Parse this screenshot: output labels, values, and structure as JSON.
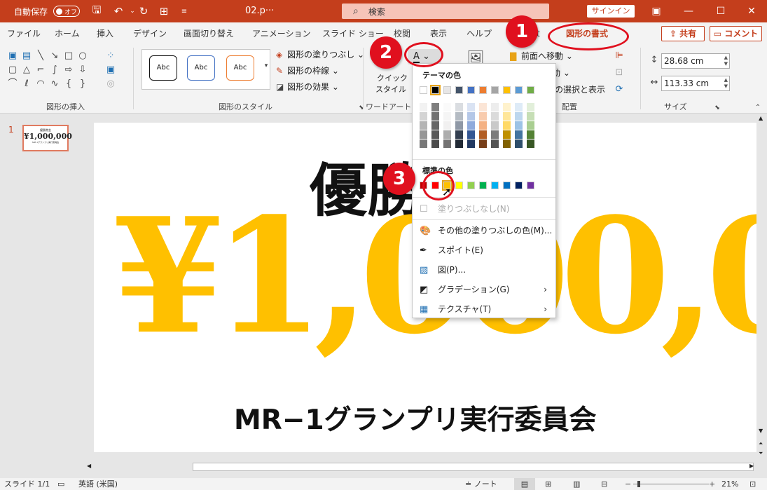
{
  "titlebar": {
    "autosave_label": "自動保存",
    "autosave_state": "オフ",
    "filename": "02.p···",
    "search_placeholder": "検索",
    "signin_label": "サインイン"
  },
  "tabs": [
    "ファイル",
    "ホーム",
    "挿入",
    "デザイン",
    "画面切り替え",
    "アニメーション",
    "スライド ショー",
    "校閲",
    "表示",
    "ヘルプ",
    "t",
    "図形の書式"
  ],
  "tab_buttons": {
    "share": "共有",
    "comment": "コメント"
  },
  "ribbon": {
    "insert_shapes_label": "図形の挿入",
    "shape_styles_label": "図形のスタイル",
    "style_sample": "Abc",
    "fill_label": "図形の塗りつぶし",
    "outline_label": "図形の枠線",
    "effects_label": "図形の効果",
    "quick_style_label": "クイック",
    "quick_style_label2": "スタイル",
    "wordart_label": "ワードアートの",
    "bring_forward": "前面へ移動",
    "send_backward": "動",
    "selection_pane": "の選択と表示",
    "arrange_label": "配置",
    "height_value": "28.68 cm",
    "width_value": "113.33 cm",
    "size_label": "サイズ"
  },
  "slide": {
    "number": "1",
    "heading": "優勝",
    "amount": "¥1,000,000",
    "committee": "MR−1グランプリ実行委員会"
  },
  "thumb": {
    "line1": "優勝賞金",
    "line2": "¥1,000,000",
    "line3": "MR-1グランプリ実行委員会"
  },
  "dropdown": {
    "theme_colors_label": "テーマの色",
    "standard_colors_label": "標準の色",
    "no_fill": "塗りつぶしなし(N)",
    "more_colors": "その他の塗りつぶしの色(M)...",
    "eyedropper": "スポイト(E)",
    "picture": "図(P)...",
    "gradient": "グラデーション(G)",
    "texture": "テクスチャ(T)",
    "theme_row": [
      "#ffffff",
      "#000000",
      "#e7e6e6",
      "#44546a",
      "#4472c4",
      "#ed7d31",
      "#a5a5a5",
      "#ffc000",
      "#5b9bd5",
      "#70ad47"
    ],
    "standard_row": [
      "#c00000",
      "#ff0000",
      "#ffc000",
      "#ffff00",
      "#92d050",
      "#00b050",
      "#00b0f0",
      "#0070c0",
      "#002060",
      "#7030a0"
    ]
  },
  "callouts": [
    "1",
    "2",
    "3"
  ],
  "status": {
    "slide_info": "スライド 1/1",
    "language": "英語 (米国)",
    "notes": "ノート",
    "zoom": "21%"
  },
  "colors": {
    "accent": "#c43e1c",
    "amount_gold": "#ffc000",
    "callout_red": "#e0101e"
  }
}
